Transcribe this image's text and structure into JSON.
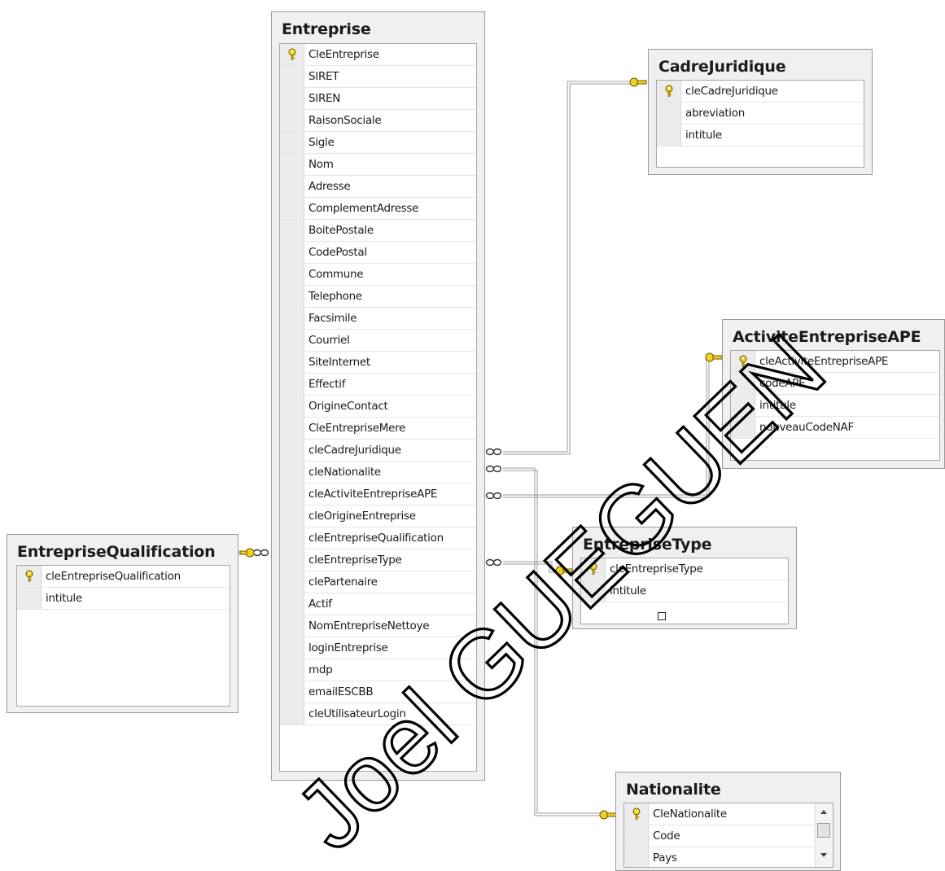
{
  "tables": {
    "entreprise": {
      "title": "Entreprise",
      "columns": [
        "CleEntreprise",
        "SIRET",
        "SIREN",
        "RaisonSociale",
        "Sigle",
        "Nom",
        "Adresse",
        "ComplementAdresse",
        "BoitePostale",
        "CodePostal",
        "Commune",
        "Telephone",
        "Facsimile",
        "Courriel",
        "SiteInternet",
        "Effectif",
        "OrigineContact",
        "CleEntrepriseMere",
        "cleCadreJuridique",
        "cleNationalite",
        "cleActiviteEntrepriseAPE",
        "cleOrigineEntreprise",
        "cleEntrepriseQualification",
        "cleEntrepriseType",
        "clePartenaire",
        "Actif",
        "NomEntrepriseNettoye",
        "loginEntreprise",
        "mdp",
        "emailESCBB",
        "cleUtilisateurLogin"
      ]
    },
    "cadre_juridique": {
      "title": "CadreJuridique",
      "columns": [
        "cleCadreJuridique",
        "abreviation",
        "intitule"
      ]
    },
    "activite_entreprise_ape": {
      "title": "ActiviteEntrepriseAPE",
      "columns": [
        "cleActiviteEntrepriseAPE",
        "codeAPE",
        "intitule",
        "nouveauCodeNAF"
      ]
    },
    "entreprise_type": {
      "title": "EntrepriseType",
      "columns": [
        "cleEntrepriseType",
        "intitule"
      ]
    },
    "entreprise_qualification": {
      "title": "EntrepriseQualification",
      "columns": [
        "cleEntrepriseQualification",
        "intitule"
      ]
    },
    "nationalite": {
      "title": "Nationalite",
      "columns": [
        "CleNationalite",
        "Code",
        "Pays"
      ]
    }
  },
  "icons": {
    "primary_key": "key-icon",
    "one_end": "key-icon",
    "many_end": "infinity-icon"
  },
  "colors": {
    "key": "#e8c200",
    "line": "#808080",
    "watermark": "#000000"
  },
  "watermark": "Joel GUEGUEN"
}
